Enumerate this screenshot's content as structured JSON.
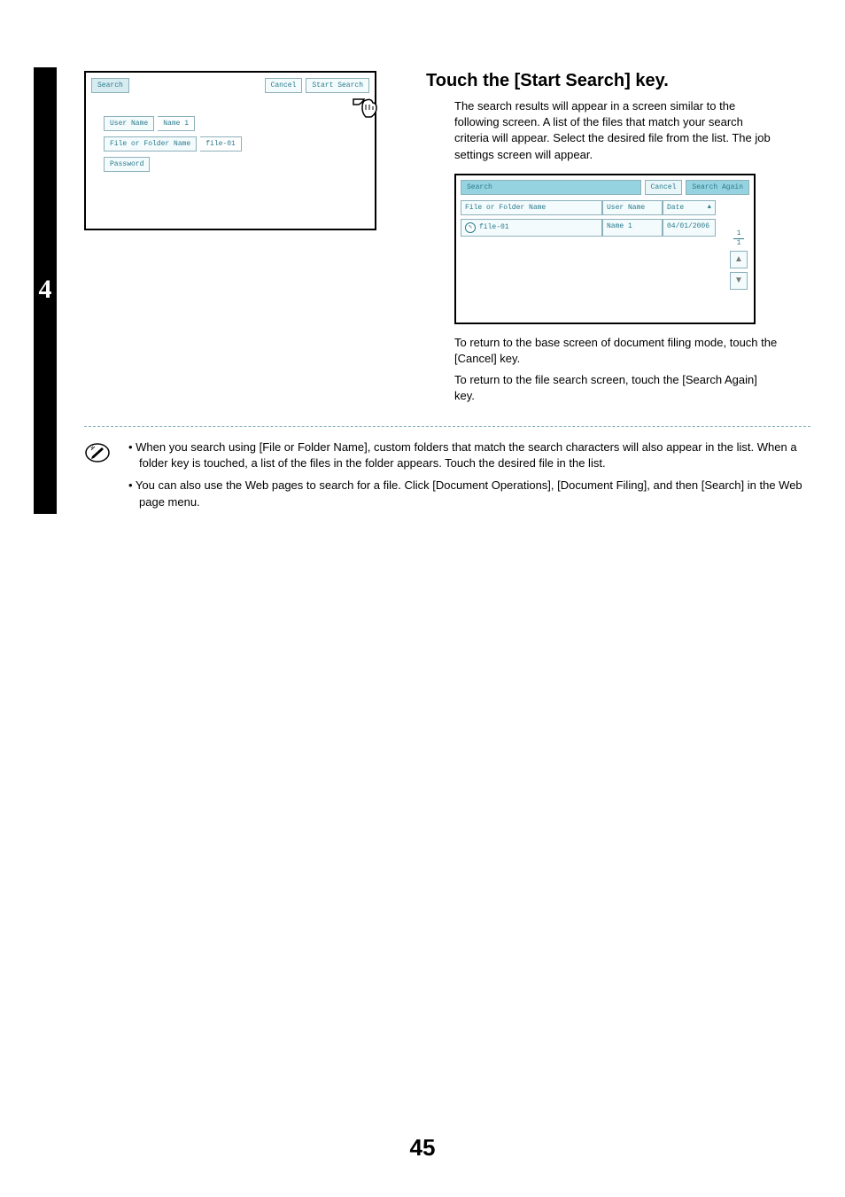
{
  "step_number": "4",
  "left_panel": {
    "title": "Search",
    "cancel": "Cancel",
    "start_search": "Start Search",
    "rows": {
      "user_name_label": "User Name",
      "user_name_value": "Name 1",
      "file_folder_label": "File or Folder Name",
      "file_folder_value": "file-01",
      "password_label": "Password"
    }
  },
  "heading": "Touch the [Start Search] key.",
  "para1": "The search results will appear in a screen similar to the following screen. A list of the files that match your search criteria will appear. Select the desired file from the list. The job settings screen will appear.",
  "results_panel": {
    "title": "Search",
    "cancel": "Cancel",
    "search_again": "Search Again",
    "columns": {
      "file_folder": "File or Folder Name",
      "user_name": "User Name",
      "date": "Date"
    },
    "rows": [
      {
        "file": "file-01",
        "user": "Name 1",
        "date": "04/01/2006"
      }
    ],
    "page_current": "1",
    "page_total": "1"
  },
  "para2": "To return to the base screen of document filing mode, touch the [Cancel] key.",
  "para3": "To return to the file search screen, touch the [Search Again] key.",
  "notes": {
    "b1": "• When you search using [File or Folder Name], custom folders that match the search characters will also appear in the list. When a folder key is touched, a list of the files in the folder appears. Touch the desired file in the list.",
    "b2": "• You can also use the Web pages to search for a file. Click [Document Operations], [Document Filing], and then [Search] in the Web page menu."
  },
  "page_number": "45"
}
